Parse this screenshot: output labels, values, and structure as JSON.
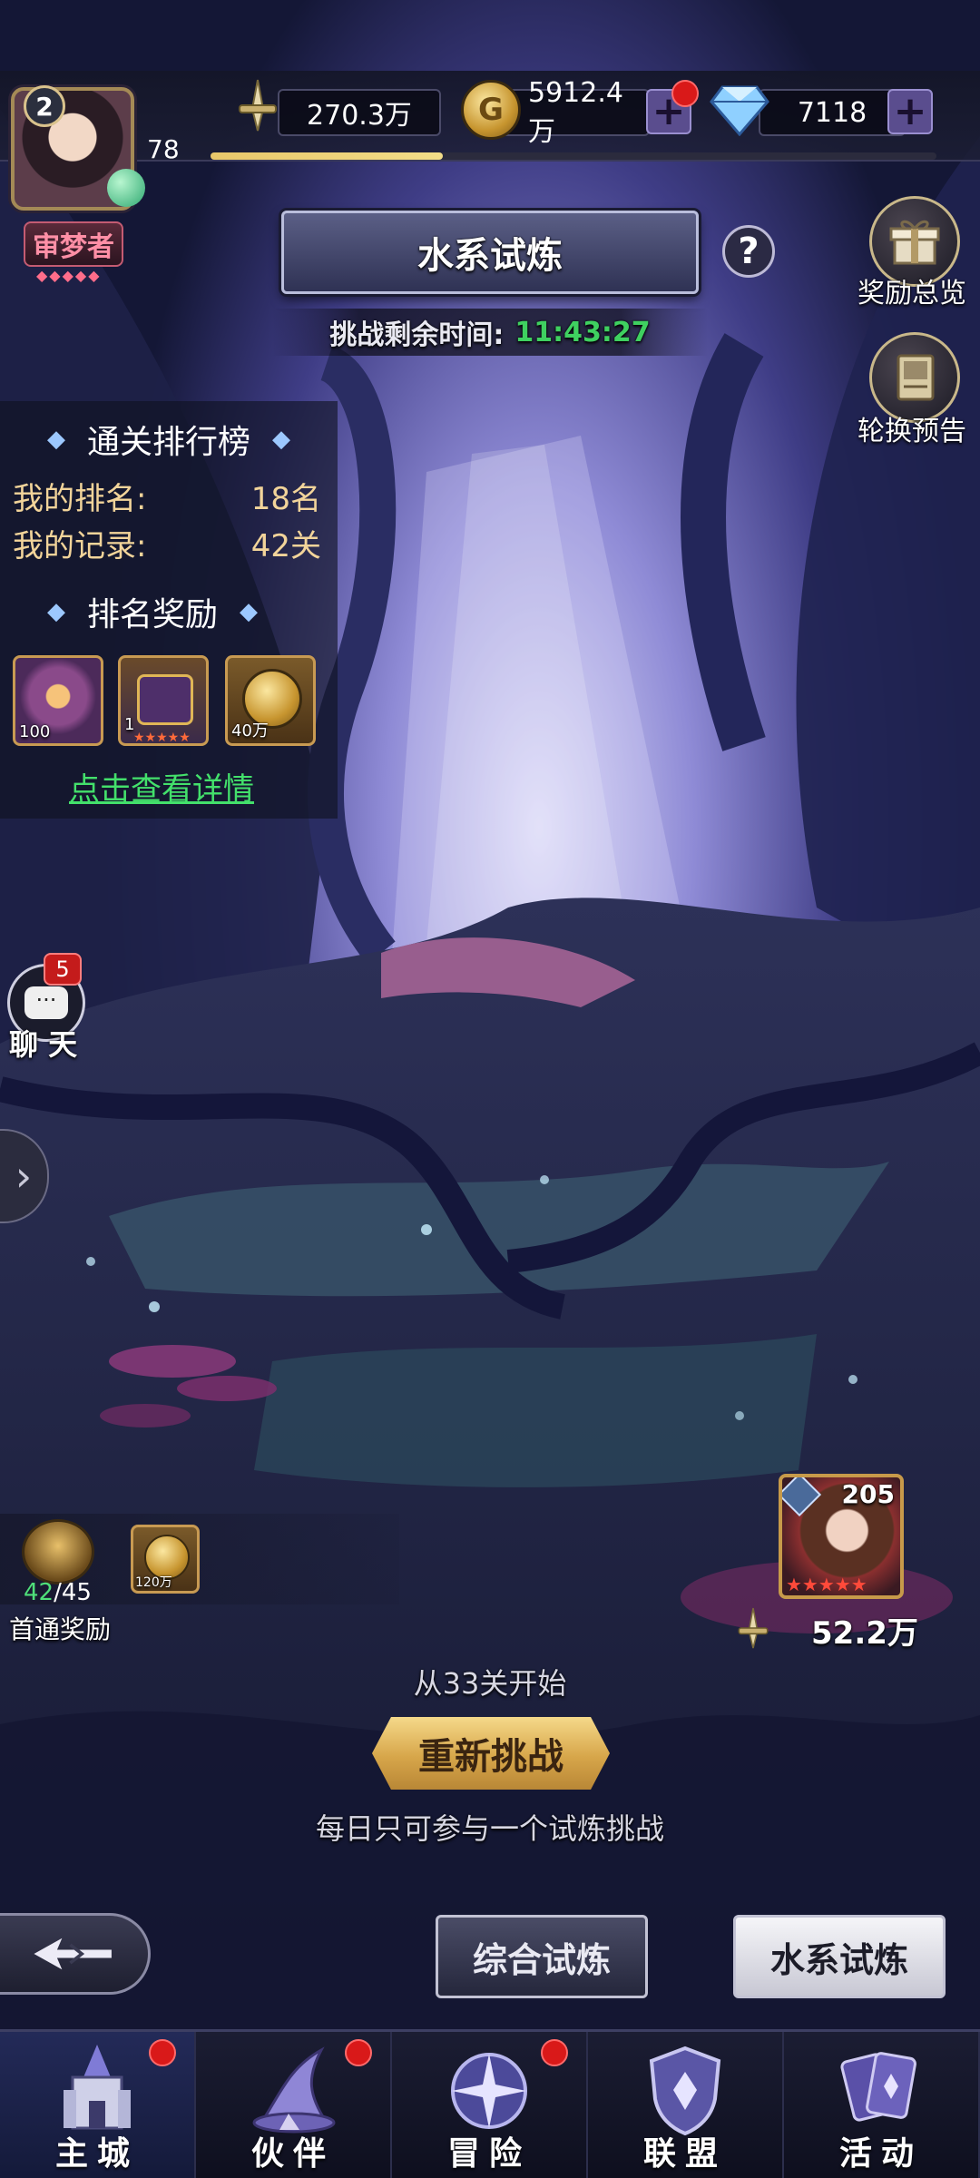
{
  "header": {
    "level": "2",
    "player_level": "78",
    "title_badge": "审梦者",
    "power": "270.3万",
    "gold": "5912.4万",
    "diamonds": "7118",
    "exp_fraction": 0.32
  },
  "trial": {
    "title": "水系试炼",
    "countdown_label": "挑战剩余时间:",
    "countdown": "11:43:27"
  },
  "side_buttons": {
    "rewards_overview": "奖励总览",
    "rotation_preview": "轮换预告",
    "chat_label": "聊 天",
    "chat_badge": "5"
  },
  "ranking": {
    "title": "通关排行榜",
    "my_rank_label": "我的排名:",
    "my_rank": "18名",
    "my_record_label": "我的记录:",
    "my_record": "42关",
    "reward_title": "排名奖励",
    "rewards": [
      {
        "name": "orb",
        "qty": "100"
      },
      {
        "name": "chest",
        "qty": "1"
      },
      {
        "name": "gold-coin",
        "qty": "40万"
      }
    ],
    "details_link": "点击查看详情"
  },
  "first_clear": {
    "progress_done": "42",
    "progress_total": "/45",
    "label": "首通奖励",
    "reward_qty": "120万"
  },
  "hero": {
    "level": "205",
    "power": "52.2万"
  },
  "challenge": {
    "start_from": "从33关开始",
    "retry_button": "重新挑战",
    "daily_note": "每日只可参与一个试炼挑战"
  },
  "trial_tabs": {
    "general": "综合试炼",
    "water": "水系试炼"
  },
  "nav": [
    {
      "label": "主城",
      "dot": true
    },
    {
      "label": "伙伴",
      "dot": true
    },
    {
      "label": "冒险",
      "dot": true
    },
    {
      "label": "联盟",
      "dot": false
    },
    {
      "label": "活动",
      "dot": false
    }
  ],
  "colors": {
    "accent_gold": "#e8c76a",
    "link_green": "#43e06b",
    "timer_green": "#3fd060",
    "badge_red": "#d91919"
  }
}
